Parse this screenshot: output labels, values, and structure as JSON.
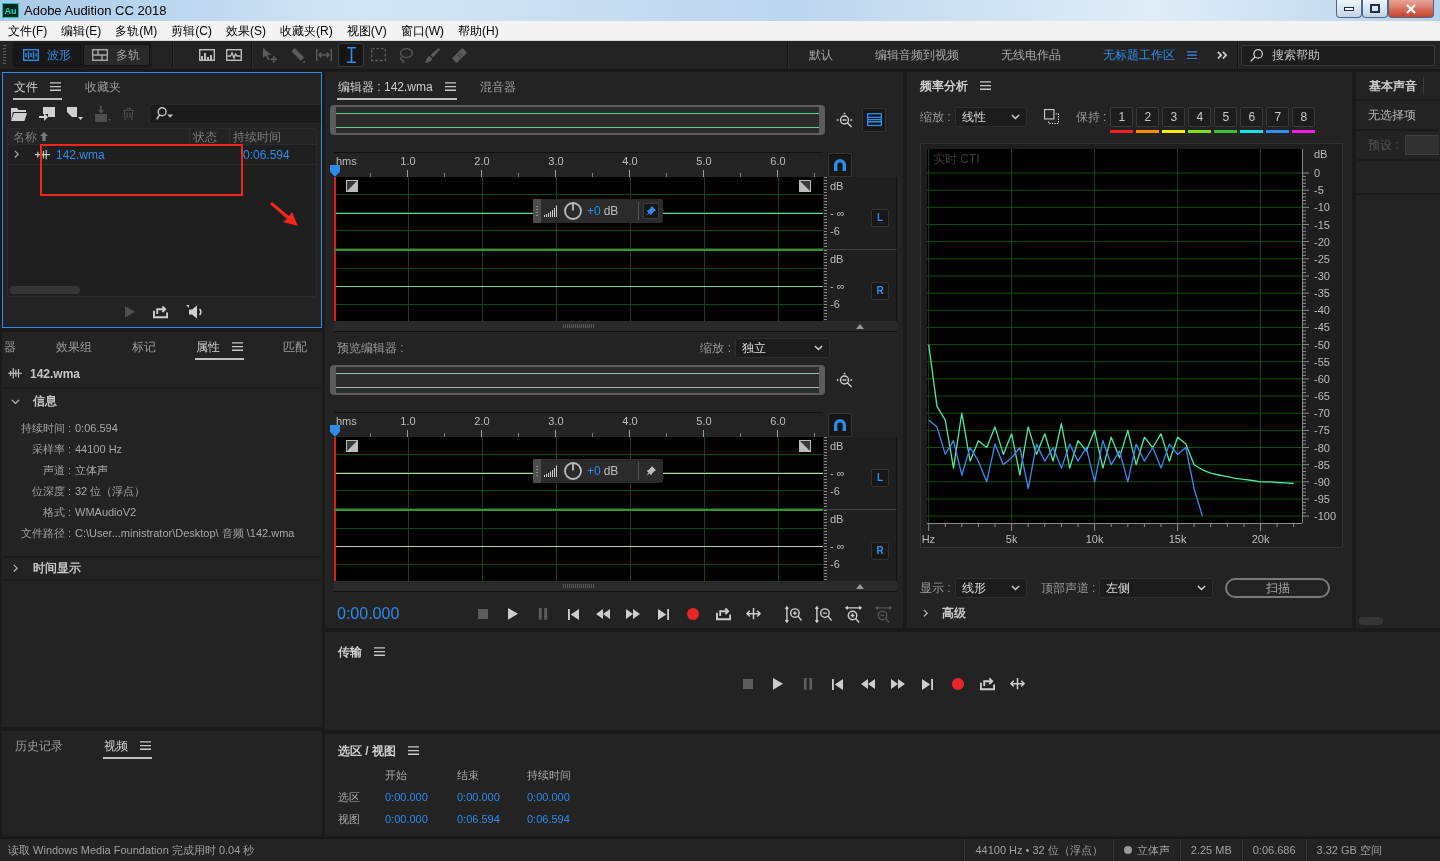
{
  "window": {
    "logo": "Au",
    "title": "Adobe Audition CC 2018"
  },
  "menu": [
    "文件(F)",
    "编辑(E)",
    "多轨(M)",
    "剪辑(C)",
    "效果(S)",
    "收藏夹(R)",
    "视图(V)",
    "窗口(W)",
    "帮助(H)"
  ],
  "toolbar": {
    "modes": [
      {
        "kind": "waveform",
        "label": "波形",
        "selected": true
      },
      {
        "kind": "multitrack",
        "label": "多轨",
        "selected": false
      }
    ],
    "display_tools": [
      {
        "kind": "spectral",
        "selected": false,
        "disabled": false
      },
      {
        "kind": "pitch",
        "selected": false,
        "disabled": false
      }
    ],
    "edit_tools": [
      {
        "kind": "move",
        "selected": false,
        "disabled": true
      },
      {
        "kind": "razor",
        "selected": false,
        "disabled": true
      },
      {
        "kind": "slip",
        "selected": false,
        "disabled": true
      },
      {
        "kind": "time-selection",
        "selected": true,
        "disabled": false
      },
      {
        "kind": "marquee",
        "selected": false,
        "disabled": true
      },
      {
        "kind": "lasso",
        "selected": false,
        "disabled": true
      },
      {
        "kind": "brush",
        "selected": false,
        "disabled": true
      },
      {
        "kind": "heal",
        "selected": false,
        "disabled": true
      }
    ],
    "workspaces": [
      {
        "label": "默认",
        "selected": false
      },
      {
        "label": "编辑音频到视频",
        "selected": false
      },
      {
        "label": "无线电作品",
        "selected": false
      },
      {
        "label": "无标题工作区",
        "selected": true
      }
    ],
    "search": {
      "placeholder": "搜索帮助"
    }
  },
  "files": {
    "focused": true,
    "tabs": [
      {
        "label": "文件",
        "selected": true
      },
      {
        "label": "收藏夹",
        "selected": false
      }
    ],
    "tools": [
      {
        "kind": "open",
        "disabled": false
      },
      {
        "kind": "import",
        "disabled": false
      },
      {
        "kind": "new",
        "disabled": false
      },
      {
        "kind": "insert",
        "disabled": true
      },
      {
        "kind": "delete",
        "disabled": true
      }
    ],
    "columns": [
      {
        "label": "名称",
        "sorted": true
      },
      {
        "label": "状态",
        "sorted": false
      },
      {
        "label": "持续时间",
        "sorted": false
      }
    ],
    "rows": [
      {
        "name": "142.wma",
        "duration": "0:06.594",
        "expanded": false,
        "open": true
      }
    ],
    "footer": [
      {
        "kind": "play",
        "disabled": true
      },
      {
        "kind": "loop",
        "disabled": false
      },
      {
        "kind": "autoplay",
        "disabled": false
      }
    ],
    "annotations": {
      "rectangle": true,
      "arrow": true
    }
  },
  "properties": {
    "tabs": [
      {
        "label": "器",
        "selected": false
      },
      {
        "label": "效果组",
        "selected": false
      },
      {
        "label": "标记",
        "selected": false
      },
      {
        "label": "属性",
        "selected": true
      },
      {
        "label": "匹配",
        "selected": false
      }
    ],
    "file": "142.wma",
    "sections": [
      {
        "title": "信息",
        "expanded": true,
        "fields": [
          {
            "label": "持续时间 :",
            "value": "0:06.594"
          },
          {
            "label": "采样率 :",
            "value": "44100 Hz"
          },
          {
            "label": "声道 :",
            "value": "立体声"
          },
          {
            "label": "位深度 :",
            "value": "32 位（浮点）"
          },
          {
            "label": "格式 :",
            "value": "WMAudioV2"
          },
          {
            "label": "文件路径 :",
            "value": "C:\\User...ministrator\\Desktop\\ 音频 \\142.wma"
          }
        ]
      },
      {
        "title": "时间显示",
        "expanded": false
      }
    ]
  },
  "history": {
    "tabs": [
      {
        "label": "历史记录",
        "selected": false
      },
      {
        "label": "视频",
        "selected": true
      }
    ]
  },
  "editor": {
    "tabs": [
      {
        "label": "编辑器 : 142.wma",
        "selected": true
      },
      {
        "label": "混音器",
        "selected": false
      }
    ],
    "snapping": true,
    "ruler": [
      "hms",
      "1.0",
      "2.0",
      "3.0",
      "4.0",
      "5.0",
      "6.0"
    ],
    "channels": [
      {
        "label": "L",
        "scale": [
          "dB",
          "- ∞",
          "-6"
        ]
      },
      {
        "label": "R",
        "scale": [
          "dB",
          "- ∞",
          "-6"
        ]
      }
    ],
    "hud": {
      "gain": "+0",
      "unit": "dB",
      "pinned": true
    }
  },
  "preview": {
    "label": "预览编辑器 :",
    "zoom_label": "缩放 :",
    "zoom_value": "独立",
    "snapping": true,
    "ruler": [
      "hms",
      "1.0",
      "2.0",
      "3.0",
      "4.0",
      "5.0",
      "6.0"
    ],
    "channels": [
      {
        "label": "L",
        "scale": [
          "dB",
          "- ∞",
          "-6"
        ]
      },
      {
        "label": "R",
        "scale": [
          "dB",
          "- ∞",
          "-6"
        ]
      }
    ],
    "hud": {
      "gain": "+0",
      "unit": "dB",
      "pinned": false
    }
  },
  "editor_transport": {
    "time": "0:00.000",
    "buttons": [
      {
        "kind": "stop",
        "disabled": true
      },
      {
        "kind": "play",
        "disabled": false
      },
      {
        "kind": "pause",
        "disabled": true
      },
      {
        "kind": "previous",
        "disabled": false
      },
      {
        "kind": "rewind",
        "disabled": false
      },
      {
        "kind": "forward",
        "disabled": false
      },
      {
        "kind": "next",
        "disabled": false
      },
      {
        "kind": "record",
        "disabled": false
      },
      {
        "kind": "loop",
        "disabled": false
      },
      {
        "kind": "skip",
        "disabled": false
      }
    ],
    "zoom": [
      {
        "kind": "zoom-in-amplitude",
        "disabled": false
      },
      {
        "kind": "zoom-out-amplitude",
        "disabled": false
      },
      {
        "kind": "zoom-in-center",
        "disabled": false
      },
      {
        "kind": "zoom-out-full",
        "disabled": true
      }
    ]
  },
  "frequency": {
    "title": "频率分析",
    "scale_label": "缩放 :",
    "scale_value": "线性",
    "hold_label": "保持 :",
    "holds": [
      {
        "label": "1",
        "color": "#ff1e1e"
      },
      {
        "label": "2",
        "color": "#ff8c00"
      },
      {
        "label": "3",
        "color": "#ffee00"
      },
      {
        "label": "4",
        "color": "#80e01c"
      },
      {
        "label": "5",
        "color": "#3cc03c"
      },
      {
        "label": "6",
        "color": "#14e0f0"
      },
      {
        "label": "7",
        "color": "#2f8ff0"
      },
      {
        "label": "8",
        "color": "#ee1ee8"
      }
    ],
    "cti_label": "实时 CTI",
    "chart_data": {
      "type": "line",
      "grid": true,
      "ylabel": "dB",
      "x": [
        0,
        500,
        1000,
        1500,
        2000,
        2500,
        3000,
        3500,
        4000,
        4500,
        5000,
        5500,
        6000,
        6500,
        7000,
        7500,
        8000,
        8500,
        9000,
        9500,
        10000,
        10500,
        11000,
        11500,
        12000,
        12500,
        13000,
        13500,
        14000,
        14500,
        15000,
        15500,
        16000,
        16500,
        17000,
        17500,
        18000,
        18500,
        19000,
        19500,
        20000,
        20500,
        21000,
        21500,
        22000
      ],
      "series": [
        {
          "color": "#4fe8a4",
          "values": [
            -50,
            -68,
            -72,
            -86,
            -70,
            -84,
            -78,
            -80,
            -74,
            -82,
            -76,
            -88,
            -74,
            -82,
            -76,
            -84,
            -73,
            -86,
            -78,
            -81,
            -75,
            -86,
            -77,
            -83,
            -75,
            -85,
            -77,
            -80,
            -76,
            -84,
            -77,
            -79,
            -85,
            -86.5,
            -87.5,
            -88,
            -88.5,
            -89,
            -89.3,
            -89.6,
            -90,
            -90,
            -90.2,
            -90.3,
            -90.5
          ]
        },
        {
          "color": "#3a8cf0",
          "values": [
            -72,
            -74,
            -82,
            -78,
            -88,
            -80,
            -84,
            -90,
            -79,
            -85,
            -83,
            -80,
            -92,
            -79,
            -84,
            -80,
            -86,
            -79,
            -84,
            -80,
            -90,
            -78,
            -85,
            -81,
            -90,
            -79,
            -84,
            -80,
            -86,
            -79,
            -82,
            -80,
            -92,
            -100,
            null,
            null,
            null,
            null,
            null,
            null,
            null,
            null,
            null,
            null,
            null
          ]
        }
      ],
      "xlim": [
        -100,
        22500
      ],
      "ylim": [
        -102,
        7
      ],
      "xticks": [
        {
          "value": 0,
          "label": "Hz"
        },
        {
          "value": 5000,
          "label": "5k"
        },
        {
          "value": 10000,
          "label": "10k"
        },
        {
          "value": 15000,
          "label": "15k"
        },
        {
          "value": 20000,
          "label": "20k"
        }
      ],
      "yticks": [
        0,
        -5,
        -10,
        -15,
        -20,
        -25,
        -30,
        -35,
        -40,
        -45,
        -50,
        -55,
        -60,
        -65,
        -70,
        -75,
        -80,
        -85,
        -90,
        -95,
        -100
      ]
    },
    "display_label": "显示 :",
    "display_value": "线形",
    "channel_label": "顶部声道 :",
    "channel_value": "左侧",
    "scan_button": "扫描",
    "advanced": {
      "label": "高级",
      "expanded": false
    }
  },
  "basic_sound": {
    "title": "基本声音",
    "empty": "无选择项",
    "preset_label": "预设 :",
    "preset_disabled": true
  },
  "transport": {
    "title": "传输",
    "buttons": [
      {
        "kind": "stop",
        "disabled": true
      },
      {
        "kind": "play",
        "disabled": false
      },
      {
        "kind": "pause",
        "disabled": true
      },
      {
        "kind": "previous",
        "disabled": false
      },
      {
        "kind": "rewind",
        "disabled": false
      },
      {
        "kind": "forward",
        "disabled": false
      },
      {
        "kind": "next",
        "disabled": false
      },
      {
        "kind": "record",
        "disabled": false
      },
      {
        "kind": "loop",
        "disabled": false
      },
      {
        "kind": "skip",
        "disabled": false
      }
    ]
  },
  "selection_view": {
    "title": "选区 / 视图",
    "columns": [
      "开始",
      "结束",
      "持续时间"
    ],
    "rows": [
      {
        "label": "选区",
        "values": [
          "0:00.000",
          "0:00.000",
          "0:00.000"
        ]
      },
      {
        "label": "视图",
        "values": [
          "0:00.000",
          "0:06.594",
          "0:06.594"
        ]
      }
    ]
  },
  "status": {
    "message": "读取 Windows Media Foundation 完成用时 0.04 秒",
    "items": [
      {
        "text": "44100 Hz • 32 位（浮点）",
        "dot": false
      },
      {
        "text": "立体声",
        "dot": true
      },
      {
        "text": "2.25 MB",
        "dot": false
      },
      {
        "text": "0:06.686",
        "dot": false
      },
      {
        "text": "3.32 GB 空间",
        "dot": false
      }
    ]
  }
}
